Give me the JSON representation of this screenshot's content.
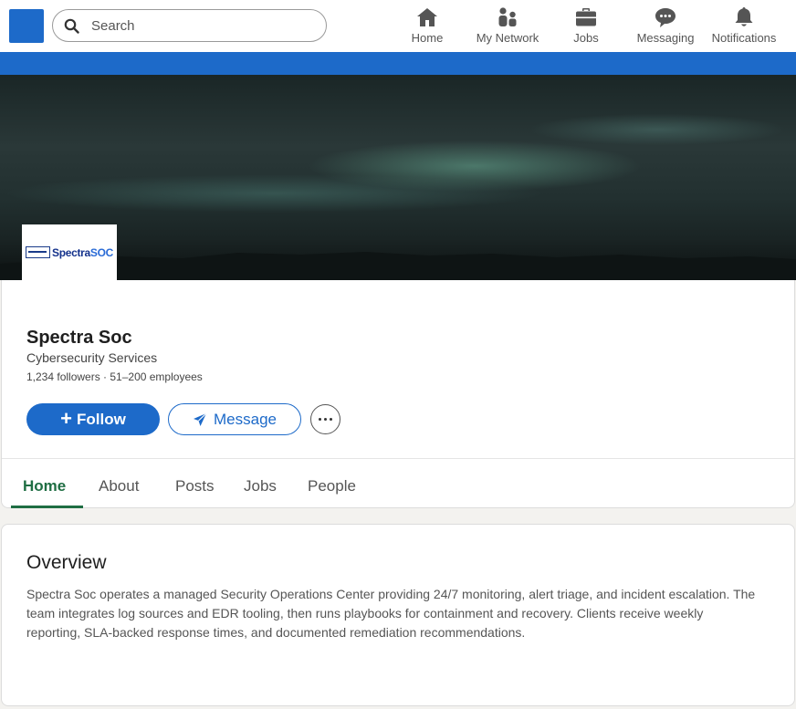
{
  "nav": {
    "search_placeholder": "Search",
    "items": [
      {
        "label": "Home",
        "icon": "home-icon"
      },
      {
        "label": "My Network",
        "icon": "network-icon"
      },
      {
        "label": "Jobs",
        "icon": "briefcase-icon"
      },
      {
        "label": "Messaging",
        "icon": "messaging-icon"
      },
      {
        "label": "Notifications",
        "icon": "bell-icon"
      }
    ]
  },
  "colors": {
    "brand_blue": "#1d6ac9",
    "active_tab_green": "#1f6e43",
    "page_background": "#f3f2ef"
  },
  "company": {
    "logo_text_primary": "Spectra",
    "logo_text_accent": "SOC",
    "name": "Spectra Soc",
    "industry": "Cybersecurity Services",
    "stats": "1,234 followers · 51–200 employees"
  },
  "actions": {
    "follow": "Follow",
    "message": "Message"
  },
  "tabs": [
    {
      "label": "Home",
      "active": true
    },
    {
      "label": "About",
      "active": false
    },
    {
      "label": "Posts",
      "active": false
    },
    {
      "label": "Jobs",
      "active": false
    },
    {
      "label": "People",
      "active": false
    }
  ],
  "overview": {
    "title": "Overview",
    "text": "Spectra Soc operates a managed Security Operations Center providing 24/7 monitoring, alert triage, and incident escalation. The team integrates log sources and EDR tooling, then runs playbooks for containment and recovery. Clients receive weekly reporting, SLA-backed response times, and documented remediation recommendations."
  }
}
